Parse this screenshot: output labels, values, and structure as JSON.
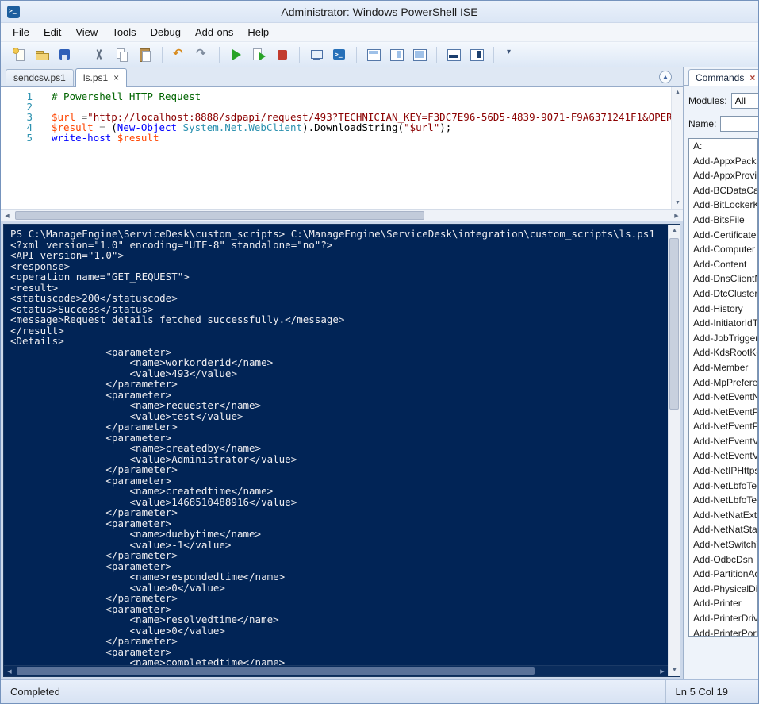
{
  "window": {
    "title": "Administrator: Windows PowerShell ISE"
  },
  "menu": {
    "items": [
      "File",
      "Edit",
      "View",
      "Tools",
      "Debug",
      "Add-ons",
      "Help"
    ]
  },
  "toolbar": {
    "icons": [
      "new-script-icon",
      "open-icon",
      "save-icon",
      "|",
      "cut-icon",
      "copy-icon",
      "paste-icon",
      "|",
      "undo-icon",
      "redo-icon",
      "|",
      "run-script-icon",
      "run-selection-icon",
      "stop-icon",
      "|",
      "new-remote-tab-icon",
      "start-powershell-icon",
      "|",
      "script-pane-top-icon",
      "script-pane-right-icon",
      "script-pane-max-icon",
      "|",
      "show-console-pane-icon",
      "show-addons-pane-icon",
      "|",
      "toolbar-overflow-icon"
    ]
  },
  "tabs": {
    "close_glyph": "×",
    "items": [
      {
        "label": "sendcsv.ps1",
        "active": false
      },
      {
        "label": "ls.ps1",
        "active": true
      }
    ]
  },
  "editor": {
    "lines": [
      {
        "num": "1",
        "segments": [
          {
            "t": "# Powershell HTTP Request",
            "c": "comment"
          }
        ]
      },
      {
        "num": "2",
        "segments": []
      },
      {
        "num": "3",
        "segments": [
          {
            "t": "$url ",
            "c": "variable"
          },
          {
            "t": "=",
            "c": "operator"
          },
          {
            "t": "\"http://localhost:8888/sdpapi/request/493?TECHNICIAN_KEY=F3DC7E96-56D5-4839-9071-F9A6371241F1&OPERAT",
            "c": "string"
          }
        ]
      },
      {
        "num": "4",
        "segments": [
          {
            "t": "$result",
            "c": "variable"
          },
          {
            "t": " = ",
            "c": "operator"
          },
          {
            "t": "(",
            "c": "default"
          },
          {
            "t": "New-Object",
            "c": "cmdlet"
          },
          {
            "t": " System.Net.WebClient",
            "c": "type"
          },
          {
            "t": ")",
            "c": "default"
          },
          {
            "t": ".DownloadString(",
            "c": "default"
          },
          {
            "t": "\"$url\"",
            "c": "string"
          },
          {
            "t": ");",
            "c": "default"
          }
        ]
      },
      {
        "num": "5",
        "segments": [
          {
            "t": "write-host",
            "c": "cmdlet"
          },
          {
            "t": " ",
            "c": "default"
          },
          {
            "t": "$result",
            "c": "variable"
          }
        ]
      }
    ]
  },
  "console": {
    "lines": [
      "PS C:\\ManageEngine\\ServiceDesk\\custom_scripts> C:\\ManageEngine\\ServiceDesk\\integration\\custom_scripts\\ls.ps1",
      "<?xml version=\"1.0\" encoding=\"UTF-8\" standalone=\"no\"?>",
      "<API version=\"1.0\">",
      "<response>",
      "<operation name=\"GET_REQUEST\">",
      "<result>",
      "<statuscode>200</statuscode>",
      "<status>Success</status>",
      "<message>Request details fetched successfully.</message>",
      "</result>",
      "<Details>",
      "                <parameter>",
      "                    <name>workorderid</name>",
      "                    <value>493</value>",
      "                </parameter>",
      "                <parameter>",
      "                    <name>requester</name>",
      "                    <value>test</value>",
      "                </parameter>",
      "                <parameter>",
      "                    <name>createdby</name>",
      "                    <value>Administrator</value>",
      "                </parameter>",
      "                <parameter>",
      "                    <name>createdtime</name>",
      "                    <value>1468510488916</value>",
      "                </parameter>",
      "                <parameter>",
      "                    <name>duebytime</name>",
      "                    <value>-1</value>",
      "                </parameter>",
      "                <parameter>",
      "                    <name>respondedtime</name>",
      "                    <value>0</value>",
      "                </parameter>",
      "                <parameter>",
      "                    <name>resolvedtime</name>",
      "                    <value>0</value>",
      "                </parameter>",
      "                <parameter>",
      "                    <name>completedtime</name>"
    ]
  },
  "commands_pane": {
    "tab_label": "Commands",
    "close_glyph": "×",
    "modules_label": "Modules:",
    "modules_value": "All",
    "name_label": "Name:",
    "group_header": "A:",
    "items": [
      "Add-AppxPackag",
      "Add-AppxProvisi",
      "Add-BCDataCach",
      "Add-BitLockerKe",
      "Add-BitsFile",
      "Add-CertificateEr",
      "Add-Computer",
      "Add-Content",
      "Add-DnsClientNr",
      "Add-DtcClusterTI",
      "Add-History",
      "Add-InitiatorIdTc",
      "Add-JobTrigger",
      "Add-KdsRootKey",
      "Add-Member",
      "Add-MpPreferen",
      "Add-NetEventNe",
      "Add-NetEventPa",
      "Add-NetEventPro",
      "Add-NetEventVm",
      "Add-NetEventVm",
      "Add-NetIPHttpsC",
      "Add-NetLbfoTea",
      "Add-NetLbfoTea",
      "Add-NetNatExter",
      "Add-NetNatStati",
      "Add-NetSwitchTe",
      "Add-OdbcDsn",
      "Add-PartitionAc",
      "Add-PhysicalDisk",
      "Add-Printer",
      "Add-PrinterDrive",
      "Add-PrinterPort"
    ]
  },
  "statusbar": {
    "left": "Completed",
    "position": "Ln 5 Col 19"
  },
  "colors": {
    "console_bg": "#012456",
    "console_text": "#eeedf0",
    "token_comment": "#006400",
    "token_variable": "#ff4500",
    "token_string": "#8b0000",
    "token_cmdlet": "#0000ff",
    "token_type": "#2b91af",
    "line_number": "#2b91af"
  }
}
